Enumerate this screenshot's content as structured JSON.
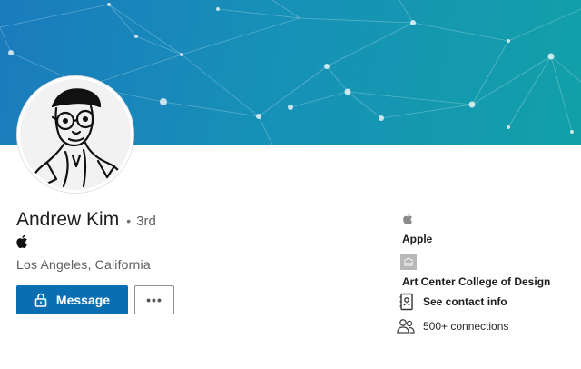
{
  "colors": {
    "banner_start": "#1a7bbd",
    "banner_end": "#12a0a8",
    "primary_button": "#0a6fb2"
  },
  "profile": {
    "name": "Andrew Kim",
    "separator": "•",
    "connection_degree": "3rd",
    "current_company_icon": "apple-logo-icon",
    "location": "Los Angeles, California"
  },
  "actions": {
    "message_label": "Message",
    "message_icon": "lock-icon",
    "more_label": "•••",
    "more_icon": "more-horizontal-icon"
  },
  "sidebar": {
    "company": {
      "icon": "apple-logo-icon",
      "name": "Apple"
    },
    "school": {
      "icon": "school-logo-icon",
      "name": "Art Center College of Design"
    },
    "contact": {
      "icon": "address-book-icon",
      "label": "See contact info"
    },
    "connections": {
      "icon": "people-icon",
      "label": "500+ connections"
    }
  }
}
